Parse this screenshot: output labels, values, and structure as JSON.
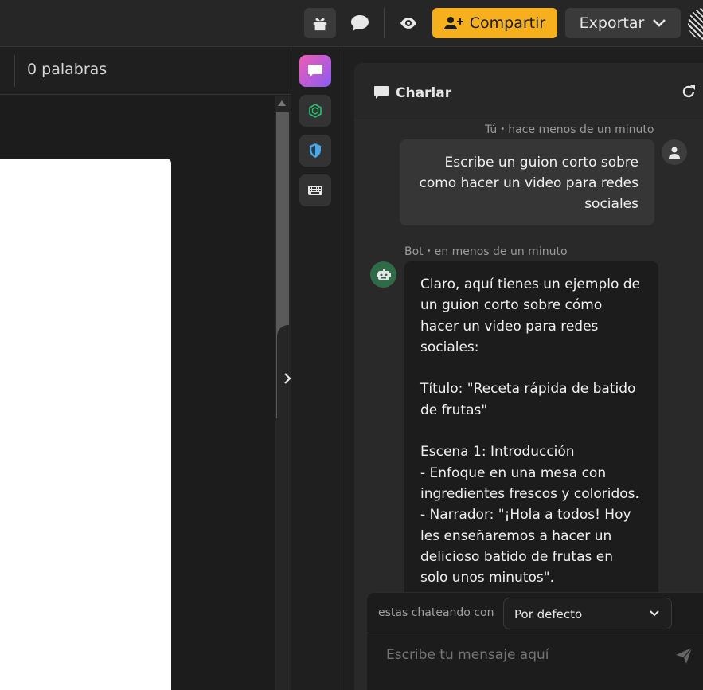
{
  "topbar": {
    "share_label": "Compartir",
    "export_label": "Exportar",
    "icons": [
      "gift-icon",
      "chat-bubble-icon",
      "eye-icon",
      "add-user-icon",
      "chevron-down-icon"
    ],
    "share_color": "#f6b01e"
  },
  "editor": {
    "word_count": "0 palabras"
  },
  "rail": {
    "items": [
      "chat-icon",
      "ai-cube-icon",
      "shield-icon",
      "keyboard-icon"
    ]
  },
  "chat": {
    "title": "Charlar",
    "user_meta": "Tú・hace menos de un minuto",
    "user_message": "Escribe un guion corto sobre como hacer un video para redes sociales",
    "bot_meta": "Bot・en menos de un minuto",
    "bot_message": "Claro, aquí tienes un ejemplo de un guion corto sobre cómo hacer un video para redes sociales:\n\nTítulo: \"Receta rápida de batido de frutas\"\n\nEscena 1: Introducción\n- Enfoque en una mesa con ingredientes frescos y coloridos.\n- Narrador: \"¡Hola a todos! Hoy les enseñaremos a hacer un delicioso batido de frutas en solo unos minutos\".",
    "model_label": "estas chateando con",
    "model_value": "Por defecto",
    "input_placeholder": "Escribe tu mensaje aquí"
  }
}
